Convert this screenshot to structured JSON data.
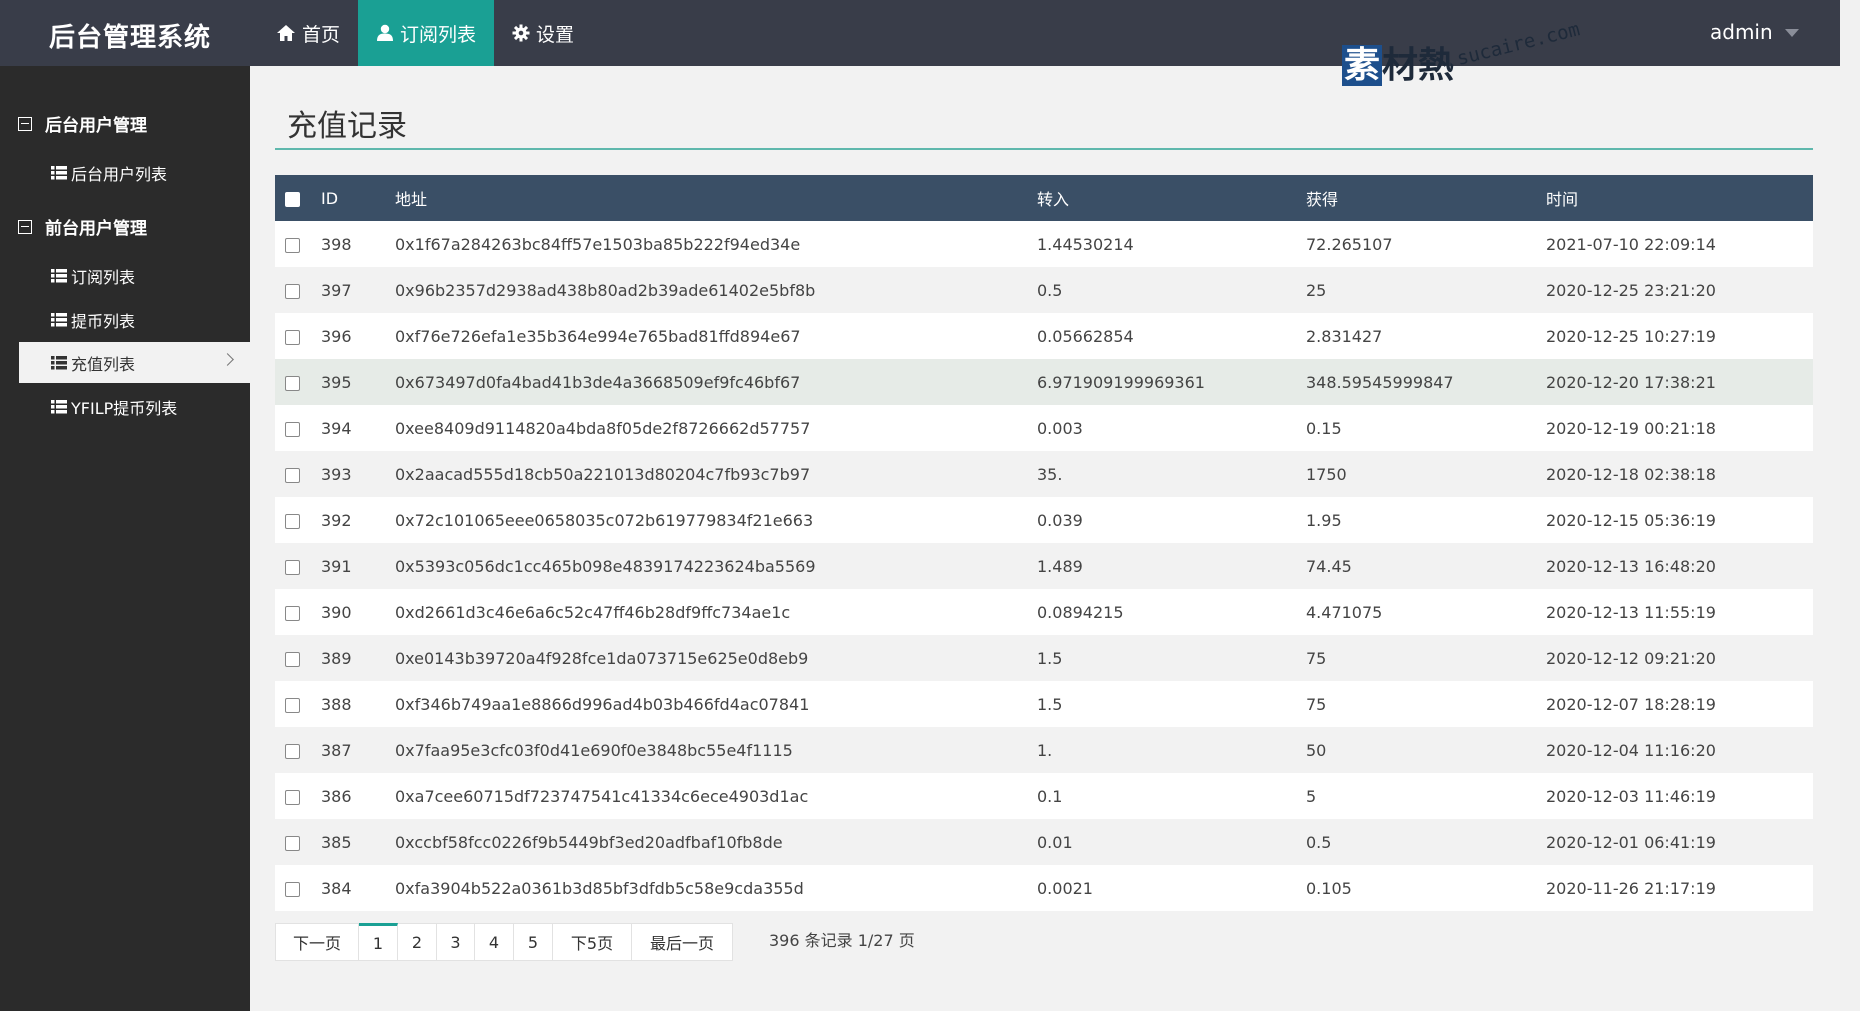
{
  "header": {
    "logo": "后台管理系统",
    "nav": [
      {
        "label": "首页",
        "icon": "home-icon"
      },
      {
        "label": "订阅列表",
        "icon": "user-icon",
        "active": true
      },
      {
        "label": "设置",
        "icon": "gear-icon"
      }
    ],
    "user": "admin",
    "accent_color": "#1aa094",
    "bar_color": "#393d49"
  },
  "watermark": {
    "logo": "素材熱",
    "url": "sucaire.com"
  },
  "sidebar": {
    "groups": [
      {
        "title": "后台用户管理",
        "items": [
          {
            "label": "后台用户列表"
          }
        ]
      },
      {
        "title": "前台用户管理",
        "items": [
          {
            "label": "订阅列表"
          },
          {
            "label": "提币列表"
          },
          {
            "label": "充值列表",
            "active": true
          },
          {
            "label": "YFILP提币列表"
          }
        ]
      }
    ]
  },
  "main": {
    "title": "充值记录",
    "table": {
      "headers": [
        "ID",
        "地址",
        "转入",
        "获得",
        "时间"
      ],
      "rows": [
        {
          "id": "398",
          "address": "0x1f67a284263bc84ff57e1503ba85b222f94ed34e",
          "in": "1.44530214",
          "get": "72.265107",
          "time": "2021-07-10 22:09:14"
        },
        {
          "id": "397",
          "address": "0x96b2357d2938ad438b80ad2b39ade61402e5bf8b",
          "in": "0.5",
          "get": "25",
          "time": "2020-12-25 23:21:20"
        },
        {
          "id": "396",
          "address": "0xf76e726efa1e35b364e994e765bad81ffd894e67",
          "in": "0.05662854",
          "get": "2.831427",
          "time": "2020-12-25 10:27:19"
        },
        {
          "id": "395",
          "address": "0x673497d0fa4bad41b3de4a3668509ef9fc46bf67",
          "in": "6.971909199969361",
          "get": "348.59545999847",
          "time": "2020-12-20 17:38:21"
        },
        {
          "id": "394",
          "address": "0xee8409d9114820a4bda8f05de2f8726662d57757",
          "in": "0.003",
          "get": "0.15",
          "time": "2020-12-19 00:21:18"
        },
        {
          "id": "393",
          "address": "0x2aacad555d18cb50a221013d80204c7fb93c7b97",
          "in": "35.",
          "get": "1750",
          "time": "2020-12-18 02:38:18"
        },
        {
          "id": "392",
          "address": "0x72c101065eee0658035c072b619779834f21e663",
          "in": "0.039",
          "get": "1.95",
          "time": "2020-12-15 05:36:19"
        },
        {
          "id": "391",
          "address": "0x5393c056dc1cc465b098e4839174223624ba5569",
          "in": "1.489",
          "get": "74.45",
          "time": "2020-12-13 16:48:20"
        },
        {
          "id": "390",
          "address": "0xd2661d3c46e6a6c52c47ff46b28df9ffc734ae1c",
          "in": "0.0894215",
          "get": "4.471075",
          "time": "2020-12-13 11:55:19"
        },
        {
          "id": "389",
          "address": "0xe0143b39720a4f928fce1da073715e625e0d8eb9",
          "in": "1.5",
          "get": "75",
          "time": "2020-12-12 09:21:20"
        },
        {
          "id": "388",
          "address": "0xf346b749aa1e8866d996ad4b03b466fd4ac07841",
          "in": "1.5",
          "get": "75",
          "time": "2020-12-07 18:28:19"
        },
        {
          "id": "387",
          "address": "0x7faa95e3cfc03f0d41e690f0e3848bc55e4f1115",
          "in": "1.",
          "get": "50",
          "time": "2020-12-04 11:16:20"
        },
        {
          "id": "386",
          "address": "0xa7cee60715df723747541c41334c6ece4903d1ac",
          "in": "0.1",
          "get": "5",
          "time": "2020-12-03 11:46:19"
        },
        {
          "id": "385",
          "address": "0xccbf58fcc0226f9b5449bf3ed20adfbaf10fb8de",
          "in": "0.01",
          "get": "0.5",
          "time": "2020-12-01 06:41:19"
        },
        {
          "id": "384",
          "address": "0xfa3904b522a0361b3d85bf3dfdb5c58e9cda355d",
          "in": "0.0021",
          "get": "0.105",
          "time": "2020-11-26 21:17:19"
        }
      ]
    },
    "pagination": {
      "prev": "下一页",
      "pages": [
        "1",
        "2",
        "3",
        "4",
        "5"
      ],
      "current": "1",
      "next5": "下5页",
      "last": "最后一页",
      "info": "396 条记录 1/27 页"
    }
  }
}
